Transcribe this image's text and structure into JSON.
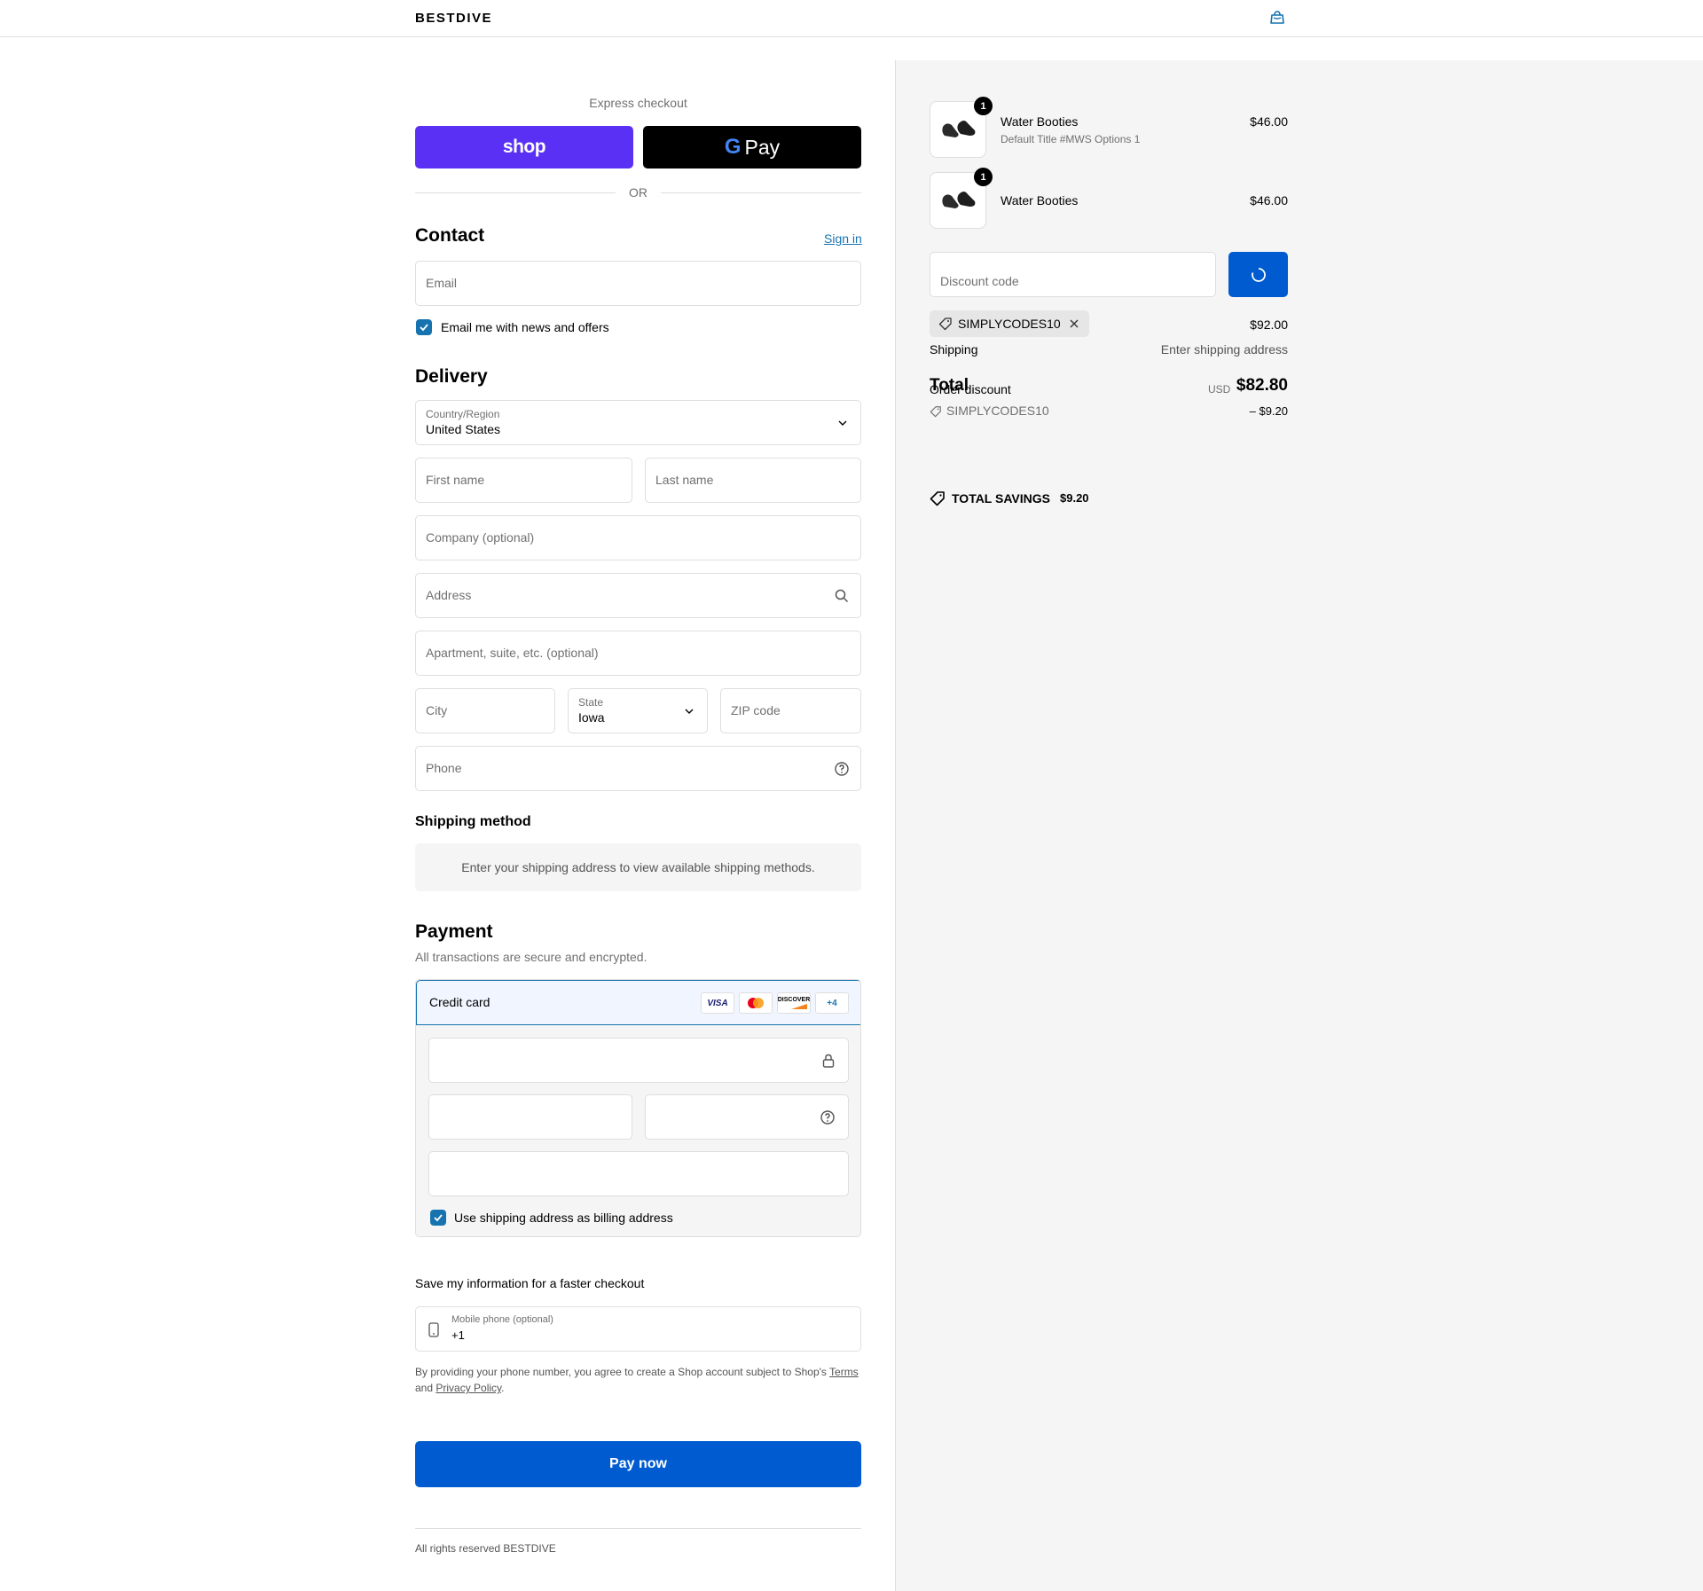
{
  "header": {
    "logo": "BESTDIVE",
    "cart_icon": "shopping-bag-icon"
  },
  "express": {
    "label": "Express checkout",
    "shop_label": "shop",
    "gpay_g": "G",
    "gpay_label": "Pay",
    "or_label": "OR"
  },
  "contact": {
    "title": "Contact",
    "sign_in": "Sign in",
    "email_placeholder": "Email",
    "news_label": "Email me with news and offers",
    "news_checked": true
  },
  "delivery": {
    "title": "Delivery",
    "country_label": "Country/Region",
    "country_value": "United States",
    "first_name": "First name",
    "last_name": "Last name",
    "company": "Company (optional)",
    "address": "Address",
    "apartment": "Apartment, suite, etc. (optional)",
    "city": "City",
    "state_label": "State",
    "state_value": "Iowa",
    "zip": "ZIP code",
    "phone": "Phone"
  },
  "shipping": {
    "title": "Shipping method",
    "info": "Enter your shipping address to view available shipping methods."
  },
  "payment": {
    "title": "Payment",
    "subtitle": "All transactions are secure and encrypted.",
    "method": "Credit card",
    "cards": [
      "VISA",
      "mastercard",
      "DISCOVER"
    ],
    "more_cards": "+4",
    "billing_label": "Use shipping address as billing address",
    "billing_checked": true
  },
  "save_info": {
    "title": "Save my information for a faster checkout",
    "mobile_label": "Mobile phone (optional)",
    "mobile_value": "+1",
    "terms_pre": "By providing your phone number, you agree to create a Shop account subject to Shop's ",
    "terms_link": "Terms",
    "terms_and": "and ",
    "privacy_link": "Privacy Policy",
    "terms_end": "."
  },
  "pay_now": "Pay now",
  "footer": "All rights reserved BESTDIVE",
  "summary": {
    "items": [
      {
        "name": "Water Booties",
        "variant": "Default Title #MWS Options 1",
        "price": "$46.00",
        "qty": "1"
      },
      {
        "name": "Water Booties",
        "variant": "",
        "price": "$46.00",
        "qty": "1"
      }
    ],
    "discount_placeholder": "Discount code",
    "applied_code": "SIMPLYCODES10",
    "subtotal_value": "$92.00",
    "shipping_label": "Shipping",
    "shipping_value": "Enter shipping address",
    "total_label": "Total",
    "order_discount_label": "Order discount",
    "currency": "USD",
    "total_value": "$82.80",
    "discount_code": "SIMPLYCODES10",
    "discount_value": "– $9.20",
    "savings_label": "TOTAL SAVINGS",
    "savings_value": "$9.20"
  },
  "colors": {
    "accent": "#005bd1",
    "shop": "#5a31f4",
    "panel": "#f5f5f5"
  }
}
